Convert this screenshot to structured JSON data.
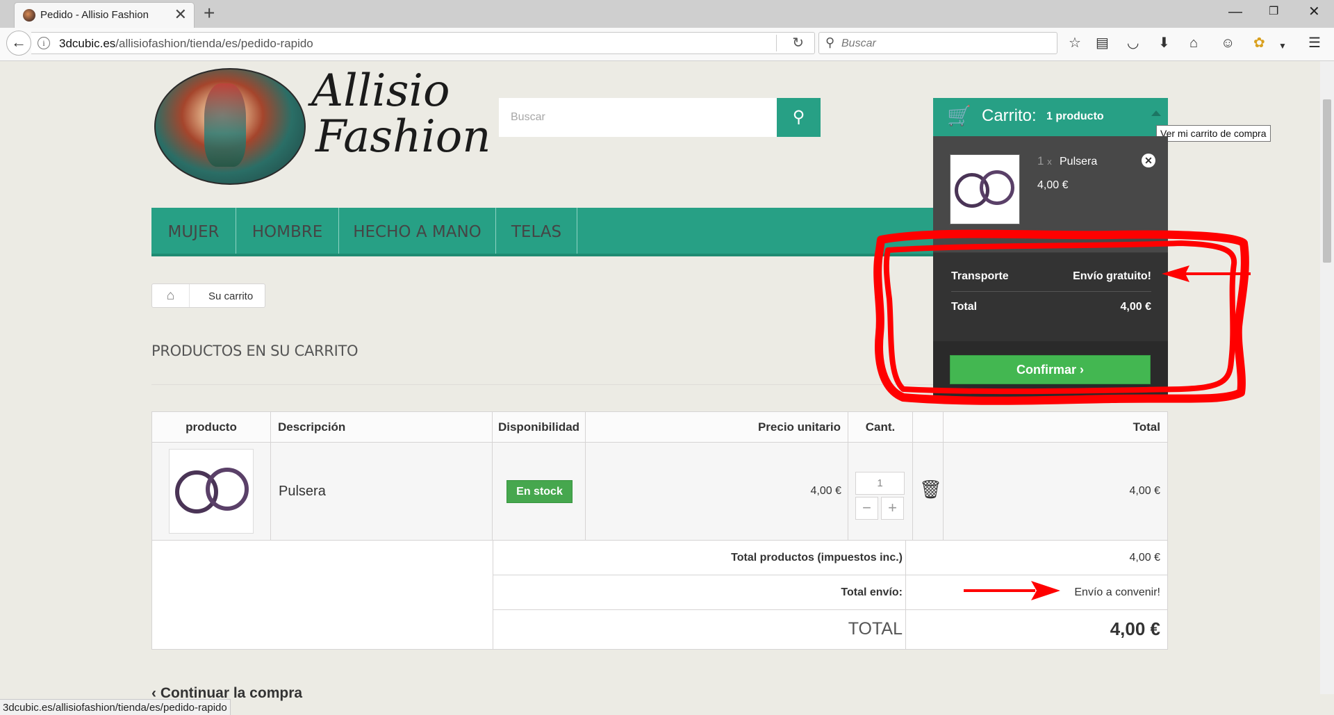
{
  "browser": {
    "tab_title": "Pedido - Allisio Fashion",
    "url_domain": "3dcubic.es",
    "url_path": "/allisiofashion/tienda/es/pedido-rapido",
    "search_placeholder": "Buscar",
    "status_url": "3dcubic.es/allisiofashion/tienda/es/pedido-rapido"
  },
  "site": {
    "logo_line1": "Allisio",
    "logo_line2": "Fashion",
    "search_placeholder": "Buscar",
    "menu": [
      "MUJER",
      "HOMBRE",
      "HECHO A MANO",
      "TELAS"
    ]
  },
  "breadcrumb": {
    "current": "Su carrito"
  },
  "page_title": "PRODUCTOS EN SU CARRITO",
  "table": {
    "headers": {
      "product": "producto",
      "description": "Descripción",
      "availability": "Disponibilidad",
      "unit_price": "Precio unitario",
      "qty": "Cant.",
      "total": "Total"
    },
    "row": {
      "name": "Pulsera",
      "availability": "En stock",
      "unit_price": "4,00 €",
      "qty": "1",
      "total": "4,00 €"
    },
    "summary": {
      "products_label": "Total productos (impuestos inc.)",
      "products_value": "4,00 €",
      "shipping_label": "Total envío:",
      "shipping_value": "Envío a convenir!",
      "total_label": "TOTAL",
      "total_value": "4,00 €"
    }
  },
  "continue_label": "Continuar la compra",
  "mini_cart": {
    "label": "Carrito:",
    "count": "1 producto",
    "tooltip": "Ver mi carrito de compra",
    "item_qty": "1",
    "item_x": "x",
    "item_name": "Pulsera",
    "item_price": "4,00 €",
    "shipping_label": "Transporte",
    "shipping_value": "Envío gratuito!",
    "total_label": "Total",
    "total_value": "4,00 €",
    "confirm_label": "Confirmar"
  },
  "colors": {
    "brand": "#27a085",
    "confirm": "#43b751",
    "annotation": "#ff0000"
  },
  "icons": [
    "back-icon",
    "info-icon",
    "reload-icon",
    "search-icon",
    "star-icon",
    "reader-icon",
    "pocket-icon",
    "download-icon",
    "home-icon",
    "emoji-icon",
    "extension-icon",
    "menu-icon",
    "cart-icon",
    "trash-icon",
    "remove-icon",
    "chevron-right-icon"
  ]
}
